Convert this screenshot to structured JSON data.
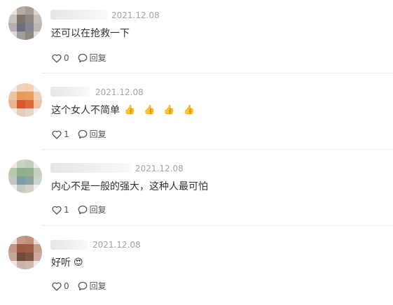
{
  "comments": [
    {
      "date": "2021.12.08",
      "text": "还可以在抢救一下",
      "emojis": [],
      "likes": "0",
      "reply_label": "回复",
      "avatar_icon": "blurred-avatar"
    },
    {
      "date": "2021.12.08",
      "text": "这个女人不简单",
      "emojis": [
        "👍",
        "👍",
        "👍",
        "👍"
      ],
      "likes": "1",
      "reply_label": "回复",
      "avatar_icon": "blurred-avatar"
    },
    {
      "date": "2021.12.08",
      "text": "内心不是一般的强大，这种人最可怕",
      "emojis": [],
      "likes": "1",
      "reply_label": "回复",
      "avatar_icon": "blurred-avatar"
    },
    {
      "date": "2021.12.08",
      "text": "好听",
      "emojis": [
        "😍"
      ],
      "likes": "0",
      "reply_label": "回复",
      "avatar_icon": "blurred-avatar"
    }
  ],
  "icons": {
    "like": "heart-icon",
    "reply": "speech-bubble-icon"
  },
  "colors": {
    "text": "#333333",
    "muted": "#a3a3a3",
    "divider": "#ececec"
  }
}
